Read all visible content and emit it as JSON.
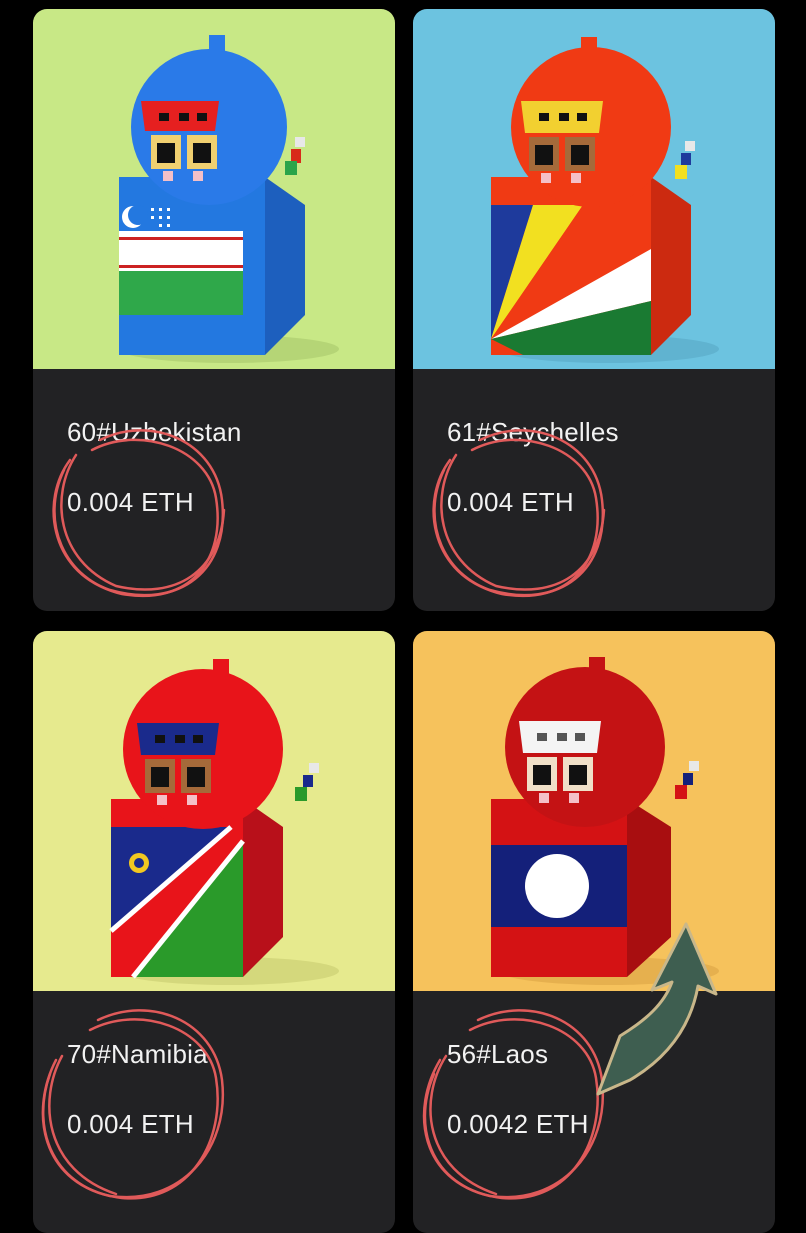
{
  "cards": [
    {
      "title": "60#Uzbekistan",
      "price": "0.004 ETH",
      "bg": "#c8e886",
      "body_color": "#1f6fd6",
      "flag": "uzbekistan"
    },
    {
      "title": "61#Seychelles",
      "price": "0.004 ETH",
      "bg": "#6cc3e0",
      "body_color": "#f03010",
      "flag": "seychelles"
    },
    {
      "title": "70#Namibia",
      "price": "0.004 ETH",
      "bg": "#e6ea8e",
      "body_color": "#e8141a",
      "flag": "namibia"
    },
    {
      "title": "56#Laos",
      "price": "0.0042 ETH",
      "bg": "#f6c25c",
      "body_color": "#d41214",
      "flag": "laos"
    }
  ],
  "annotations": {
    "circle_color": "#e05a5a",
    "arrow_color": "#3e5e50",
    "arrow_outline": "#c9b78a"
  }
}
